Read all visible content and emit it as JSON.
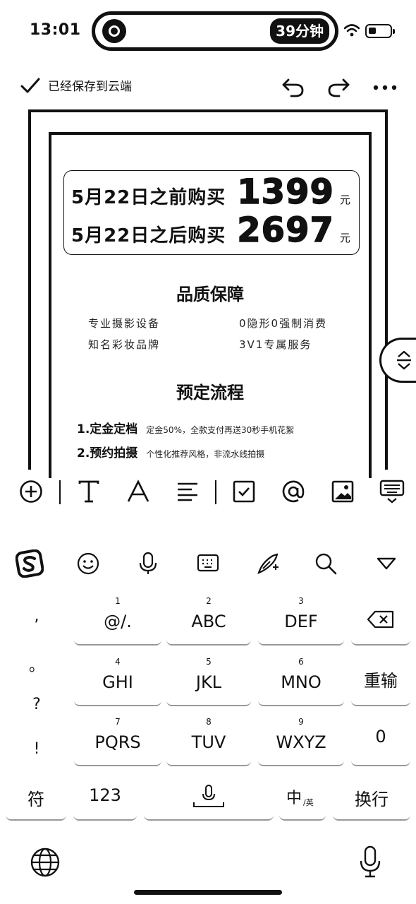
{
  "status_bar": {
    "time": "13:01",
    "timer": "39分钟",
    "icons": [
      "app-badge-icon",
      "wifi-icon",
      "battery-icon"
    ]
  },
  "doc_header": {
    "saved_text": "已经保存到云端",
    "icons": [
      "checkmark-icon",
      "undo-icon",
      "redo-icon",
      "more-icon"
    ]
  },
  "document": {
    "prices": [
      {
        "label": "5月22日之前购买",
        "amount": "1399",
        "unit": "元"
      },
      {
        "label": "5月22日之后购买",
        "amount": "2697",
        "unit": "元"
      }
    ],
    "quality": {
      "title": "品质保障",
      "items": [
        "专业摄影设备",
        "0隐形0强制消费",
        "知名彩妆品牌",
        "3V1专属服务"
      ]
    },
    "process": {
      "title": "预定流程",
      "steps": [
        {
          "title": "1.定金定档",
          "desc": "定金50%，全款支付再送30秒手机花絮"
        },
        {
          "title": "2.预约拍摄",
          "desc": "个性化推荐风格，非流水线拍摄"
        }
      ]
    }
  },
  "format_toolbar": [
    "add-icon",
    "text-style-icon",
    "font-icon",
    "align-icon",
    "checkbox-icon",
    "mention-icon",
    "image-icon",
    "keyboard-hide-icon"
  ],
  "keyboard": {
    "top_icons": [
      "sogou-logo-icon",
      "emoji-icon",
      "voice-icon",
      "keyboard-icon",
      "handwrite-icon",
      "search-icon",
      "collapse-icon"
    ],
    "punct": [
      ",",
      "。",
      "?",
      "!"
    ],
    "rows": [
      [
        {
          "num": "1",
          "label": "@/."
        },
        {
          "num": "2",
          "label": "ABC"
        },
        {
          "num": "3",
          "label": "DEF"
        }
      ],
      [
        {
          "num": "4",
          "label": "GHI"
        },
        {
          "num": "5",
          "label": "JKL"
        },
        {
          "num": "6",
          "label": "MNO"
        }
      ],
      [
        {
          "num": "7",
          "label": "PQRS"
        },
        {
          "num": "8",
          "label": "TUV"
        },
        {
          "num": "9",
          "label": "WXYZ"
        }
      ]
    ],
    "right_keys": {
      "row2": "重输",
      "row3": "0"
    },
    "bottom": {
      "symbols": "符",
      "numbers": "123",
      "zh": "中",
      "en": "/英",
      "enter": "换行"
    },
    "bottom_icons": [
      "globe-icon",
      "microphone-icon",
      "space-mic-icon",
      "backspace-icon"
    ]
  }
}
